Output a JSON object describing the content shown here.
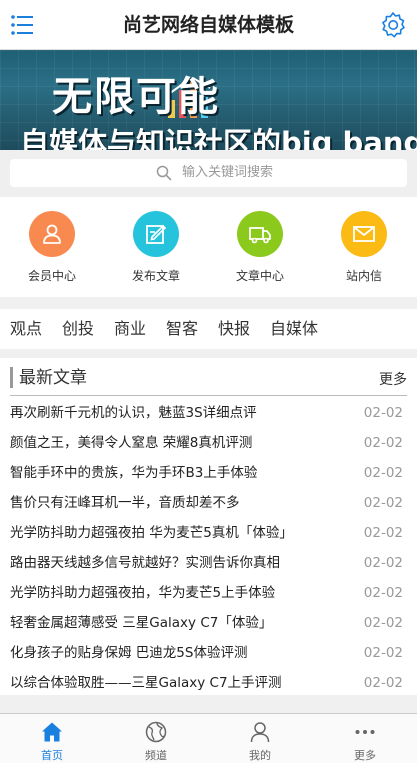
{
  "header": {
    "title": "尚艺网络自媒体模板"
  },
  "banner": {
    "headline": "无限可能",
    "subline": "自媒体与知识社区的big bang"
  },
  "search": {
    "placeholder": "输入关键词搜索"
  },
  "quick_links": [
    {
      "label": "会员中心",
      "icon": "user-icon",
      "color": "#f98a4f"
    },
    {
      "label": "发布文章",
      "icon": "edit-icon",
      "color": "#26c4dc"
    },
    {
      "label": "文章中心",
      "icon": "truck-icon",
      "color": "#8cc91d"
    },
    {
      "label": "站内信",
      "icon": "mail-icon",
      "color": "#fbba14"
    }
  ],
  "categories": [
    "观点",
    "创投",
    "商业",
    "智客",
    "快报",
    "自媒体"
  ],
  "news": {
    "title": "最新文章",
    "more": "更多",
    "items": [
      {
        "title": "再次刷新千元机的认识，魅蓝3S详细点评",
        "date": "02-02"
      },
      {
        "title": "颜值之王，美得令人窒息 荣耀8真机评测",
        "date": "02-02"
      },
      {
        "title": "智能手环中的贵族，华为手环B3上手体验",
        "date": "02-02"
      },
      {
        "title": "售价只有汪峰耳机一半，音质却差不多",
        "date": "02-02"
      },
      {
        "title": "光学防抖助力超强夜拍 华为麦芒5真机「体验」",
        "date": "02-02"
      },
      {
        "title": "路由器天线越多信号就越好？实测告诉你真相",
        "date": "02-02"
      },
      {
        "title": "光学防抖助力超强夜拍，华为麦芒5上手体验",
        "date": "02-02"
      },
      {
        "title": "轻奢金属超薄感受 三星Galaxy C7「体验」",
        "date": "02-02"
      },
      {
        "title": "化身孩子的贴身保姆 巴迪龙5S体验评测",
        "date": "02-02"
      },
      {
        "title": "以综合体验取胜——三星Galaxy C7上手评测",
        "date": "02-02"
      }
    ]
  },
  "tabbar": [
    {
      "label": "首页",
      "icon": "home-icon",
      "active": true
    },
    {
      "label": "频道",
      "icon": "globe-icon",
      "active": false
    },
    {
      "label": "我的",
      "icon": "person-icon",
      "active": false
    },
    {
      "label": "更多",
      "icon": "more-icon",
      "active": false
    }
  ],
  "colors": {
    "accent": "#1a80e0",
    "date": "#999999"
  }
}
